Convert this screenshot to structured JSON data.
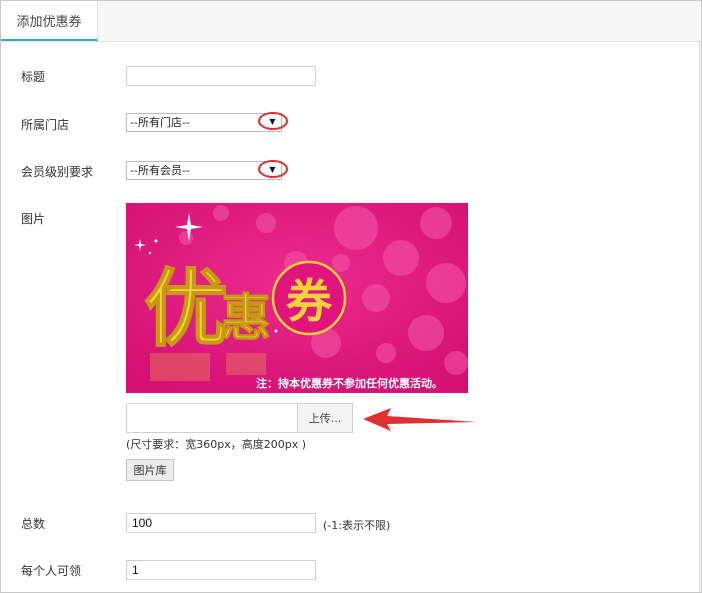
{
  "tab": {
    "label": "添加优惠券"
  },
  "form": {
    "title_label": "标题",
    "title_value": "",
    "store_label": "所属门店",
    "store_selected": "--所有门店--",
    "member_label": "会员级别要求",
    "member_selected": "--所有会员--",
    "image_label": "图片",
    "promo": {
      "big_text_1": "优",
      "big_text_2": "惠",
      "circle_text": "券",
      "note": "注：持本优惠券不参加任何优惠活动。"
    },
    "upload_button": "上传...",
    "size_hint": "(尺寸要求：宽360px，高度200px )",
    "gallery_button": "图片库",
    "total_label": "总数",
    "total_value": "100",
    "total_note": "(-1:表示不限)",
    "per_person_label": "每个人可领",
    "per_person_value": "1"
  },
  "colors": {
    "tab_accent": "#3aa7c8",
    "promo_bg": "#e0147c",
    "promo_gold": "#f3d23a",
    "annotation_red": "#e03030"
  },
  "icons": [
    "dropdown-arrow-icon",
    "red-ring-annotation",
    "red-arrow-annotation"
  ]
}
